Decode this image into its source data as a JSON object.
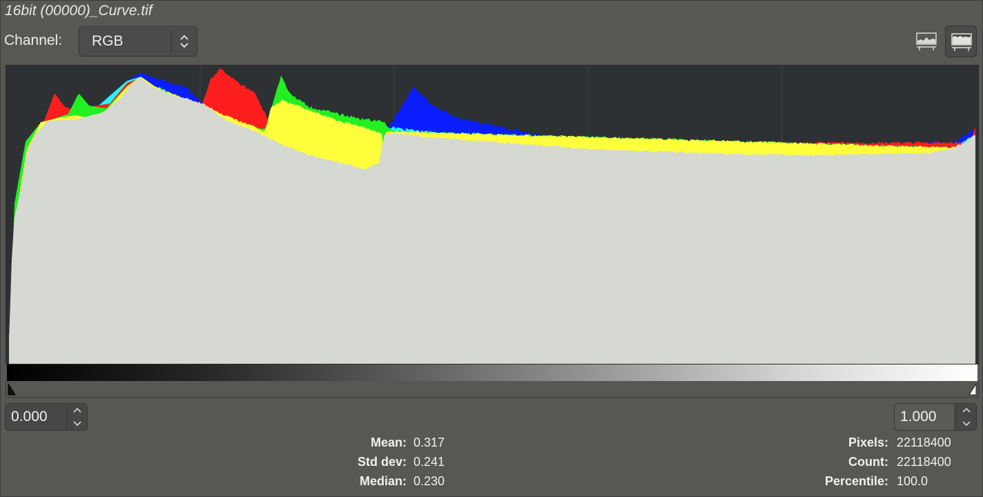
{
  "window": {
    "title": "16bit (00000)_Curve.tif"
  },
  "channel": {
    "label": "Channel:",
    "selected": "RGB"
  },
  "view_buttons": [
    {
      "name": "linear-histogram-icon"
    },
    {
      "name": "logarithmic-histogram-icon",
      "active": true
    }
  ],
  "histogram": {
    "mode": "logarithmic",
    "channels": [
      "Red",
      "Green",
      "Blue",
      "Value"
    ],
    "colors": {
      "background": "#2e3134",
      "value": "#d6d8d2",
      "red": "#ff1e1e",
      "green": "#22f022",
      "blue": "#0a1eff",
      "yellow": "#ffff3c",
      "cyan": "#20f8ff",
      "magenta": "#ff2cff"
    },
    "x_range": [
      0.0,
      1.0
    ]
  },
  "range": {
    "lower": "0.000",
    "upper": "1.000"
  },
  "stats_left": [
    {
      "label": "Mean:",
      "value": "0.317"
    },
    {
      "label": "Std dev:",
      "value": "0.241"
    },
    {
      "label": "Median:",
      "value": "0.230"
    }
  ],
  "stats_right": [
    {
      "label": "Pixels:",
      "value": "22118400"
    },
    {
      "label": "Count:",
      "value": "22118400"
    },
    {
      "label": "Percentile:",
      "value": "100.0"
    }
  ]
}
